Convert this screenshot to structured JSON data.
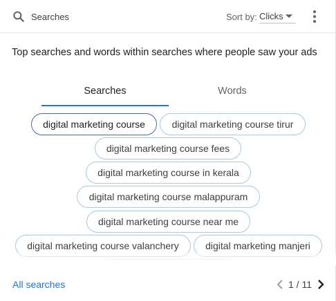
{
  "header": {
    "search_label": "Searches",
    "sort_by_label": "Sort by:",
    "sort_value": "Clicks",
    "icons": {
      "search": "search-icon",
      "dropdown": "dropdown-icon",
      "more": "more-vert-icon"
    }
  },
  "description": "Top searches and words within searches where people saw your ads",
  "tabs": [
    {
      "label": "Searches",
      "active": true
    },
    {
      "label": "Words",
      "active": false
    }
  ],
  "chips": [
    {
      "label": "digital marketing course",
      "selected": true
    },
    {
      "label": "digital marketing course tirur",
      "selected": false
    },
    {
      "label": "digital marketing course fees",
      "selected": false
    },
    {
      "label": "digital marketing course in kerala",
      "selected": false
    },
    {
      "label": "digital marketing course malappuram",
      "selected": false
    },
    {
      "label": "digital marketing course near me",
      "selected": false
    },
    {
      "label": "digital marketing course valanchery",
      "selected": false
    },
    {
      "label": "digital marketing manjeri",
      "selected": false
    }
  ],
  "footer": {
    "all_searches_label": "All searches",
    "page_indicator": "1 / 11",
    "icons": {
      "prev": "chevron-left-icon",
      "next": "chevron-right-icon"
    }
  },
  "colors": {
    "accent": "#1a73e8",
    "chip_border": "#a8c7e6",
    "chip_selected_border": "#3d6ea8",
    "text_primary": "#202124",
    "text_secondary": "#5f6368"
  }
}
